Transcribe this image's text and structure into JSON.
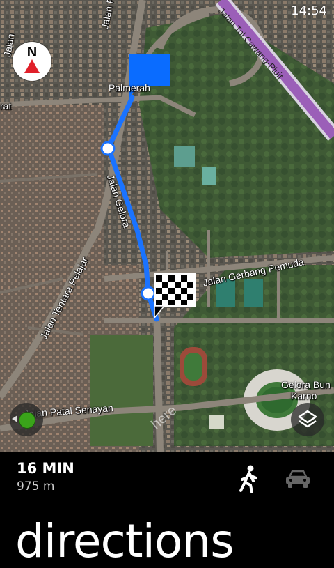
{
  "status_bar": {
    "time": "14:54"
  },
  "map": {
    "compass_label": "N",
    "watermark": "here",
    "street_labels": {
      "jalan_palmerah": "Jalan Palmerah",
      "jalan_tol": "Jalan Tol Cawang-Pluit",
      "palmerah": "Palmerah",
      "rat": "rat",
      "jalan_gelora": "Jalan Gelora",
      "jalan_tentara_pelajar": "Jalan Tentara Pelajar",
      "jalan_gerbang_pemuda": "Jalan Gerbang Pemuda",
      "jalan_patal_senayan": "Jalan Patal Senayan",
      "gelora_bung_karno_1": "Gelora Bun",
      "gelora_bung_karno_2": "Karno",
      "jalan_left": "Jalan"
    },
    "route_color": "#1a73ff",
    "start_marker_color": "#0a6cff"
  },
  "route_summary": {
    "duration": "16 MIN",
    "distance": "975 m"
  },
  "modes": {
    "walk": "walk-icon",
    "car": "car-icon"
  },
  "page_title": "directions"
}
